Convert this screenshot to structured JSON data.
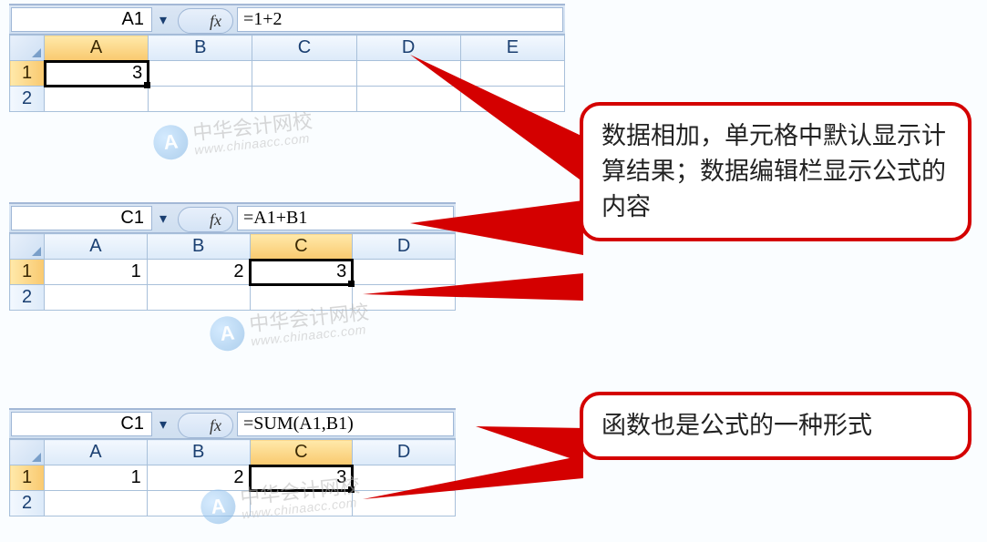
{
  "icons": {
    "fx": "fx",
    "dropdown": "▾"
  },
  "columns5": [
    "A",
    "B",
    "C",
    "D",
    "E"
  ],
  "columns4": [
    "A",
    "B",
    "C",
    "D"
  ],
  "rows": [
    "1",
    "2"
  ],
  "examples": [
    {
      "name_box": "A1",
      "formula": "=1+2",
      "active_col": "A",
      "cells": {
        "r1": {
          "A": "3",
          "B": "",
          "C": "",
          "D": "",
          "E": ""
        }
      }
    },
    {
      "name_box": "C1",
      "formula": "=A1+B1",
      "active_col": "C",
      "cells": {
        "r1": {
          "A": "1",
          "B": "2",
          "C": "3",
          "D": ""
        }
      }
    },
    {
      "name_box": "C1",
      "formula": "=SUM(A1,B1)",
      "active_col": "C",
      "cells": {
        "r1": {
          "A": "1",
          "B": "2",
          "C": "3",
          "D": ""
        }
      }
    }
  ],
  "callouts": {
    "c1": "数据相加，单元格中默认显示计算结果；数据编辑栏显示公式的内容",
    "c2": "函数也是公式的一种形式"
  },
  "watermark": {
    "name": "中华会计网校",
    "url": "www.chinaacc.com",
    "badge": "A"
  }
}
